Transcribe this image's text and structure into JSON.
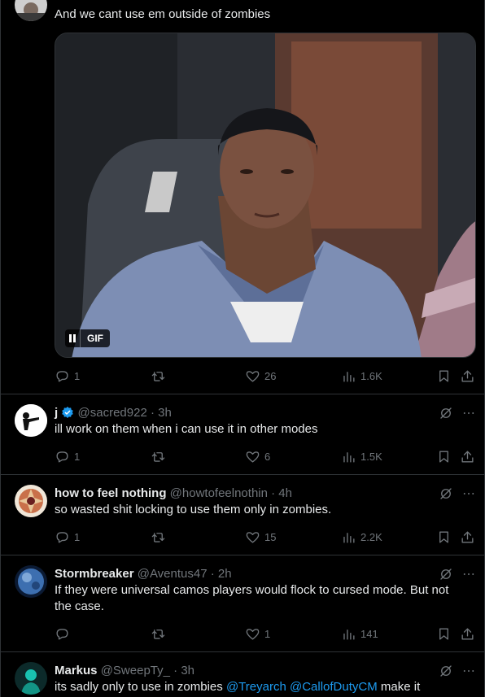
{
  "tweets": [
    {
      "text": "And we cant use em outside of zombies",
      "media": {
        "badge": "GIF"
      },
      "stats": {
        "replies": "1",
        "retweets": "",
        "likes": "26",
        "views": "1.6K"
      }
    },
    {
      "name": "j",
      "handle": "@sacred922",
      "time": "· 3h",
      "text": "ill work on them when i can use it in other modes",
      "stats": {
        "replies": "1",
        "retweets": "",
        "likes": "6",
        "views": "1.5K"
      }
    },
    {
      "name": "how to feel nothing",
      "handle": "@howtofeelnothin",
      "time": "· 4h",
      "text": "so wasted shit locking to use them only in zombies.",
      "stats": {
        "replies": "1",
        "retweets": "",
        "likes": "15",
        "views": "2.2K"
      }
    },
    {
      "name": "Stormbreaker",
      "handle": "@Aventus47",
      "time": "· 2h",
      "text": "If they were universal camos players would flock to cursed mode.  But not the case.",
      "stats": {
        "replies": "",
        "retweets": "",
        "likes": "1",
        "views": "141"
      }
    },
    {
      "name": "Markus",
      "handle": "@SweepTy_",
      "time": "· 3h",
      "text_before": "its sadly only to use in zombies ",
      "mention1": "@Treyarch",
      "space": " ",
      "mention2": "@CallofDutyCM",
      "text_after": " make it"
    }
  ],
  "icons": [
    "reply-icon",
    "retweet-icon",
    "like-icon",
    "views-icon",
    "bookmark-icon",
    "share-icon",
    "grok-icon",
    "more-icon",
    "verified-badge-icon",
    "pause-icon"
  ],
  "colors": {
    "background": "#000000",
    "text": "#e7e9ea",
    "muted": "#71767b",
    "accent": "#1d9bf0",
    "divider": "#2f3336"
  }
}
